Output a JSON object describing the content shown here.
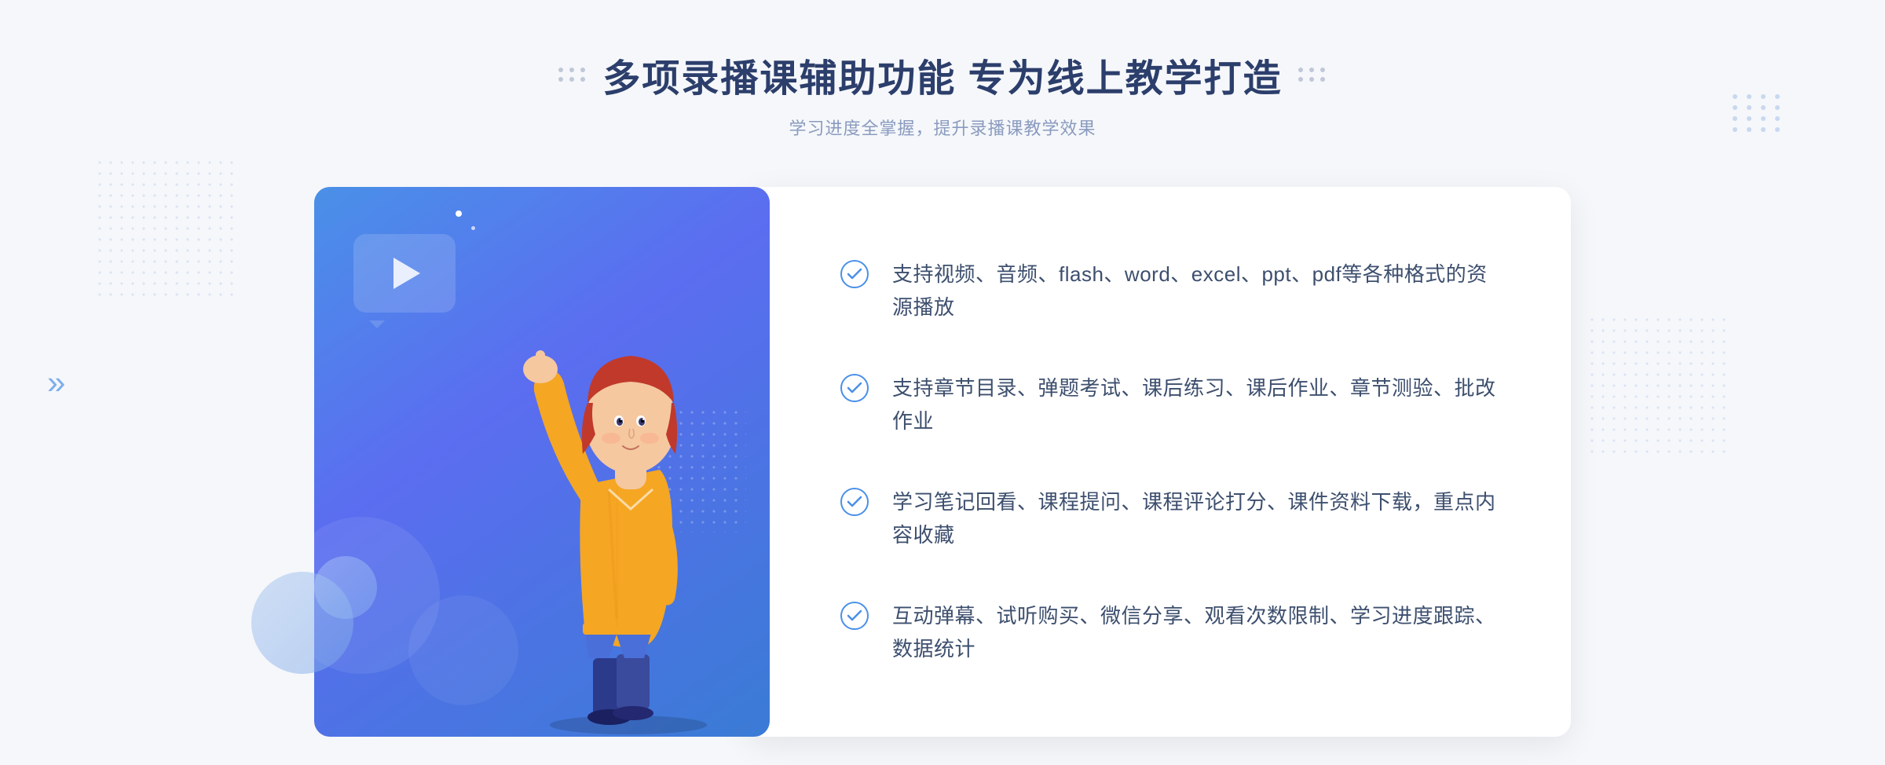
{
  "header": {
    "title": "多项录播课辅助功能 专为线上教学打造",
    "subtitle": "学习进度全掌握，提升录播课教学效果",
    "decorator_left": "❮❮",
    "decorator_right": "❯❯"
  },
  "features": [
    {
      "id": 1,
      "text": "支持视频、音频、flash、word、excel、ppt、pdf等各种格式的资源播放"
    },
    {
      "id": 2,
      "text": "支持章节目录、弹题考试、课后练习、课后作业、章节测验、批改作业"
    },
    {
      "id": 3,
      "text": "学习笔记回看、课程提问、课程评论打分、课件资料下载，重点内容收藏"
    },
    {
      "id": 4,
      "text": "互动弹幕、试听购买、微信分享、观看次数限制、学习进度跟踪、数据统计"
    }
  ],
  "left_chevron": "»",
  "colors": {
    "primary_blue": "#4a90e8",
    "dark_blue": "#2c3e6b",
    "text_color": "#3d4f6e",
    "subtitle_color": "#8a9bbf"
  }
}
